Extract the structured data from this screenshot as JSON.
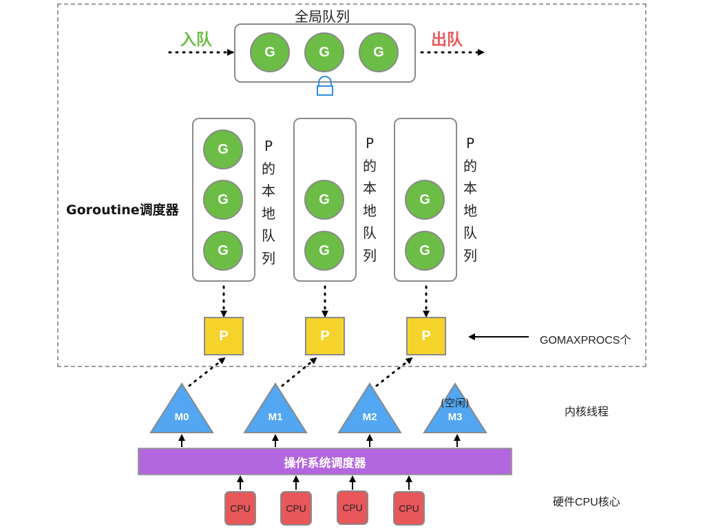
{
  "global_queue": {
    "title": "全局队列",
    "enqueue_label": "入队",
    "dequeue_label": "出队",
    "goroutines": [
      "G",
      "G",
      "G"
    ],
    "lock_icon": "lock-icon"
  },
  "scheduler_label": "Goroutine调度器",
  "local_queues": [
    {
      "label_chars": [
        "P",
        "的",
        "本",
        "地",
        "队",
        "列"
      ],
      "goroutines": [
        "G",
        "G",
        "G"
      ]
    },
    {
      "label_chars": [
        "P",
        "的",
        "本",
        "地",
        "队",
        "列"
      ],
      "goroutines": [
        "G",
        "G"
      ]
    },
    {
      "label_chars": [
        "P",
        "的",
        "本",
        "地",
        "队",
        "列"
      ],
      "goroutines": [
        "G",
        "G"
      ]
    }
  ],
  "processors": [
    "P",
    "P",
    "P"
  ],
  "gomaxprocs_label": "GOMAXPROCS个",
  "threads": [
    {
      "label": "M0",
      "note": ""
    },
    {
      "label": "M1",
      "note": ""
    },
    {
      "label": "M2",
      "note": ""
    },
    {
      "label": "M3",
      "note": "(空闲)"
    }
  ],
  "thread_row_label": "内核线程",
  "os_scheduler_label": "操作系统调度器",
  "cpus": [
    "CPU",
    "CPU",
    "CPU",
    "CPU"
  ],
  "cpu_row_label": "硬件CPU核心",
  "colors": {
    "goroutine": "#6cbd45",
    "processor": "#f6d32b",
    "thread": "#52a6f2",
    "os_scheduler": "#b266e0",
    "cpu": "#e8575a",
    "enqueue": "#6cbd45",
    "dequeue": "#e8575a",
    "lock": "#2a8de0"
  }
}
